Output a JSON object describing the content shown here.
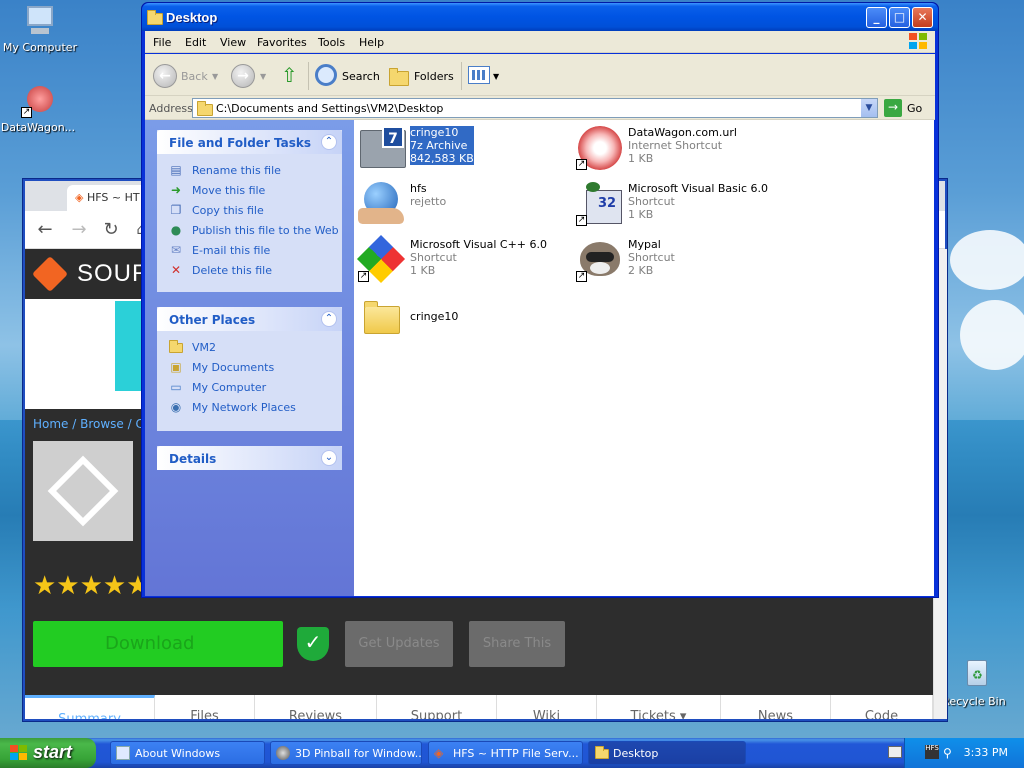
{
  "desktop": {
    "icons": [
      {
        "label": "My Computer"
      },
      {
        "label": "DataWagon..."
      },
      {
        "label": "Recycle Bin"
      }
    ]
  },
  "browser": {
    "tab_title": "HFS ~ HT",
    "logo_text": "SOUR",
    "breadcrumb": "Home / Browse / Co",
    "rating_stars": "★★★★★",
    "download_label": "Download",
    "get_updates_label": "Get Updates",
    "share_label": "Share This",
    "tabs": [
      "Summary",
      "Files",
      "Reviews",
      "Support",
      "Wiki",
      "Tickets ▾",
      "News",
      "Code"
    ]
  },
  "explorer": {
    "title": "Desktop",
    "menu": [
      "File",
      "Edit",
      "View",
      "Favorites",
      "Tools",
      "Help"
    ],
    "toolbar": {
      "back": "Back",
      "search": "Search",
      "folders": "Folders"
    },
    "address": {
      "label": "Address",
      "value": "C:\\Documents and Settings\\VM2\\Desktop",
      "go": "Go"
    },
    "tasks": {
      "header": "File and Folder Tasks",
      "items": [
        "Rename this file",
        "Move this file",
        "Copy this file",
        "Publish this file to the Web",
        "E-mail this file",
        "Delete this file"
      ]
    },
    "other_places": {
      "header": "Other Places",
      "items": [
        "VM2",
        "My Documents",
        "My Computer",
        "My Network Places"
      ]
    },
    "details": {
      "header": "Details"
    },
    "files": [
      {
        "name": "cringe10",
        "type": "7z Archive",
        "size": "842,583 KB",
        "selected": true
      },
      {
        "name": "DataWagon.com.url",
        "type": "Internet Shortcut",
        "size": "1 KB"
      },
      {
        "name": "hfs",
        "type": "rejetto",
        "size": ""
      },
      {
        "name": "Microsoft Visual Basic 6.0",
        "type": "Shortcut",
        "size": "1 KB"
      },
      {
        "name": "Microsoft Visual C++ 6.0",
        "type": "Shortcut",
        "size": "1 KB"
      },
      {
        "name": "Mypal",
        "type": "Shortcut",
        "size": "2 KB"
      },
      {
        "name": "cringe10",
        "type": "",
        "size": ""
      }
    ]
  },
  "taskbar": {
    "start": "start",
    "tasks": [
      {
        "label": "About Windows"
      },
      {
        "label": "3D Pinball for Window..."
      },
      {
        "label": "HFS ~ HTTP File Serv..."
      },
      {
        "label": "Desktop"
      }
    ],
    "clock": "3:33 PM"
  }
}
